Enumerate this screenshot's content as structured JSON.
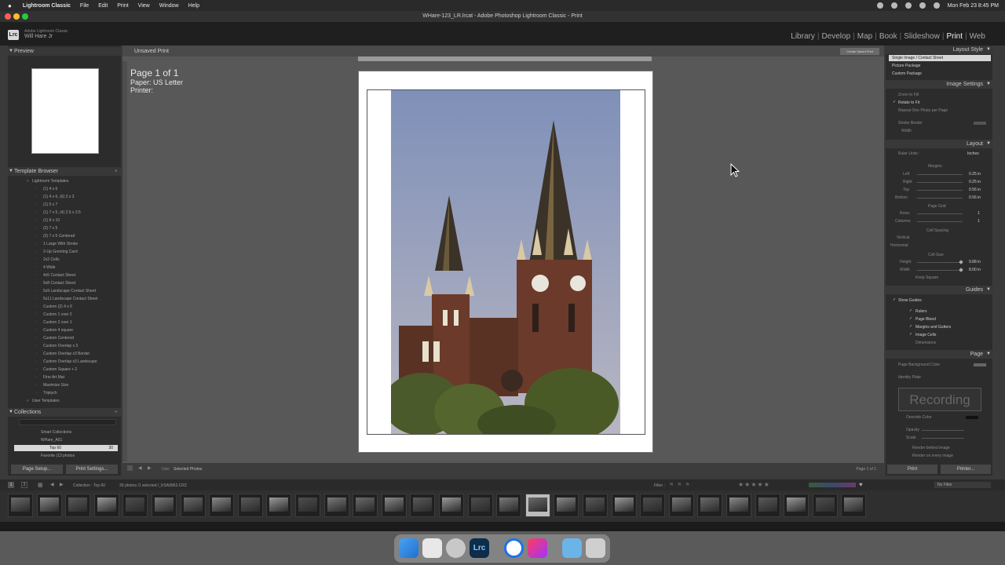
{
  "menubar": {
    "app": "Lightroom Classic",
    "items": [
      "File",
      "Edit",
      "Print",
      "View",
      "Window",
      "Help"
    ],
    "datetime": "Mon Feb 23  8:45 PM"
  },
  "window": {
    "title": "WHare-123_LR.lrcat - Adobe Photoshop Lightroom Classic - Print"
  },
  "header": {
    "product": "Adobe Lightroom Classic",
    "user": "Will Hare Jr",
    "modules": [
      "Library",
      "Develop",
      "Map",
      "Book",
      "Slideshow",
      "Print",
      "Web"
    ],
    "active_module": "Print"
  },
  "left": {
    "preview_title": "Preview",
    "template_browser_title": "Template Browser",
    "lightroom_templates_label": "Lightroom Templates",
    "templates": [
      "(1) 4 x 6",
      "(1) 4 x 6, (6) 2 x 3",
      "(1) 5 x 7",
      "(1) 7 x 5, (4) 2.5 x 3.5",
      "(1) 8 x 10",
      "(2) 7 x 5",
      "(2) 7 x 5 Centered",
      "1 Large With Stroke",
      "2-Up Greeting Card",
      "2x2 Cells",
      "4 Wide",
      "4x5 Contact Sheet",
      "5x8 Contact Sheet",
      "5x9 Landscape Contact Sheet",
      "5x11 Landscape Contact Sheet",
      "Custom (2) 4 x 6",
      "Custom 1 over 2",
      "Custom 2 over 1",
      "Custom 4 square",
      "Custom Centered",
      "Custom Overlap x 3",
      "Custom Overlap x3 Border",
      "Custom Overlap x3 Landscape",
      "Custom Square + 2",
      "Fine Art Mat",
      "Maximize Size",
      "Triptych"
    ],
    "user_templates_label": "User Templates",
    "collections_title": "Collections",
    "collections": {
      "smart": "Smart Collections",
      "set": "WHare_A01",
      "selected": "Top 60",
      "selected_count": "30",
      "next": "Favorite (13 photos"
    },
    "page_setup": "Page Setup...",
    "print_settings": "Print Settings..."
  },
  "center": {
    "unsaved": "Unsaved Print",
    "create_saved": "Create Saved Print",
    "page_of": "Page 1 of 1",
    "paper": "Paper:  US Letter",
    "printer": "Printer:",
    "use_label": "Use:",
    "use_value": "Selected Photos",
    "page_count": "Page 1 of 1"
  },
  "right": {
    "layout_style_title": "Layout Style",
    "layout_styles": [
      "Single Image / Contact Sheet",
      "Picture Package",
      "Custom Package"
    ],
    "image_settings_title": "Image Settings",
    "zoom_to_fill": "Zoom to Fill",
    "rotate_to_fit": "Rotate to Fit",
    "repeat_one": "Repeat One Photo per Page",
    "stroke_border": "Stroke Border",
    "width_label": "Width",
    "layout_title": "Layout",
    "ruler_units": "Ruler Units :",
    "ruler_units_value": "Inches",
    "margins_title": "Margins",
    "margins": [
      {
        "label": "Left",
        "value": "0.25 in"
      },
      {
        "label": "Right",
        "value": "0.25 in"
      },
      {
        "label": "Top",
        "value": "0.56 in"
      },
      {
        "label": "Bottom",
        "value": "0.56 in"
      }
    ],
    "page_grid_title": "Page Grid",
    "rows_label": "Rows",
    "rows_value": "1",
    "columns_label": "Columns",
    "columns_value": "1",
    "cell_spacing_title": "Cell Spacing",
    "vertical_label": "Vertical",
    "horizontal_label": "Horizontal",
    "cell_size_title": "Cell Size",
    "height_label": "Height",
    "height_value": "9.88 in",
    "cell_width_label": "Width",
    "cell_width_value": "8.00 in",
    "keep_square": "Keep Square",
    "guides_title": "Guides",
    "show_guides": "Show Guides",
    "guides": [
      "Rulers",
      "Page Bleed",
      "Margins and Gutters",
      "Image Cells",
      "Dimensions"
    ],
    "page_title": "Page",
    "page_bg": "Page Background Color",
    "identity_plate": "Identity Plate",
    "identity_text": "Recording",
    "override_color": "Override Color",
    "opacity_label": "Opacity",
    "scale_label": "Scale",
    "render_behind": "Render behind image",
    "render_every": "Render on every image",
    "print_btn": "Print",
    "printer_btn": "Printer..."
  },
  "filmstrip": {
    "collection_label": "Collection : Top 60",
    "count_label": "30 photos /1 selected /_KSA9963.CR3",
    "filter_label": "Filter :",
    "filter_value": "No Filter",
    "page_buttons": [
      "1",
      "2"
    ]
  },
  "colors": {
    "sky": "#8d9cbd",
    "brick": "#6b3a2a",
    "foliage": "#4b5a2a"
  }
}
